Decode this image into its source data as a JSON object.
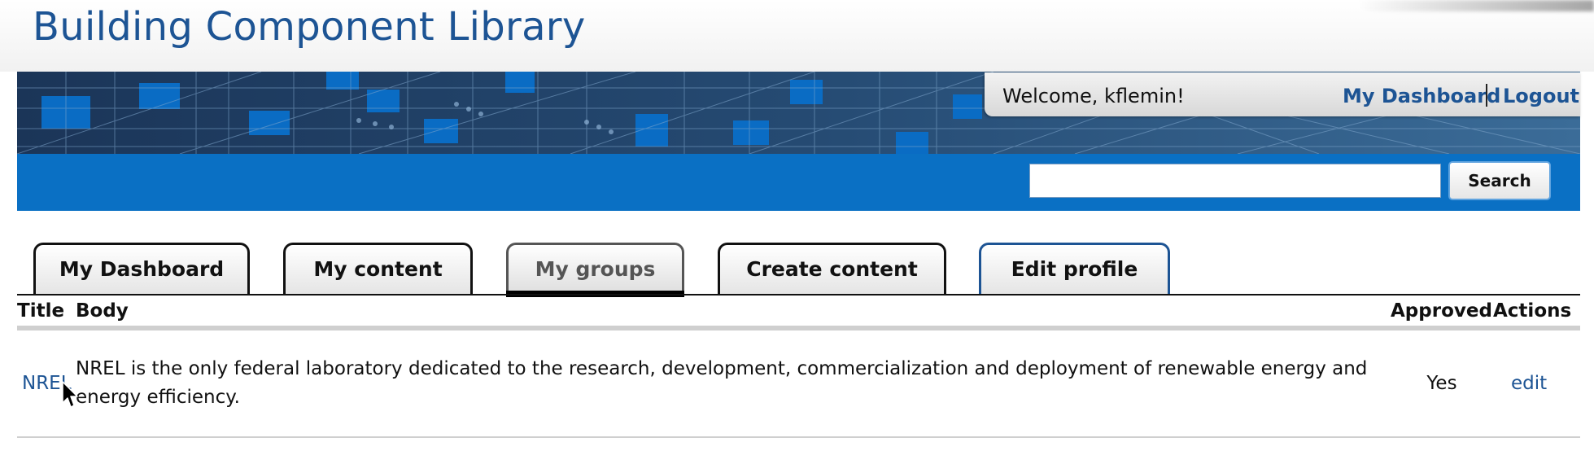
{
  "site": {
    "title": "Building Component Library"
  },
  "user_panel": {
    "welcome": "Welcome, kflemin!",
    "dashboard_link": "My Dashboard",
    "logout_link": "Logout"
  },
  "search": {
    "value": "",
    "button_label": "Search"
  },
  "tabs": [
    {
      "label": "My Dashboard"
    },
    {
      "label": "My content"
    },
    {
      "label": "My groups",
      "active": true
    },
    {
      "label": "Create content"
    },
    {
      "label": "Edit profile"
    }
  ],
  "table": {
    "headers": {
      "title": "Title",
      "body": "Body",
      "approved": "Approved",
      "actions": "Actions"
    },
    "rows": [
      {
        "title": "NREL",
        "body": "NREL is the only federal laboratory dedicated to the research, development, commercialization and deployment of renewable energy and energy efficiency.",
        "approved": "Yes",
        "action": "edit"
      }
    ]
  },
  "colors": {
    "brand_blue": "#1d5494",
    "search_strip": "#0a70c4",
    "banner_dark": "#1e3a5f"
  },
  "icons": [
    "mouse-pointer-icon"
  ]
}
